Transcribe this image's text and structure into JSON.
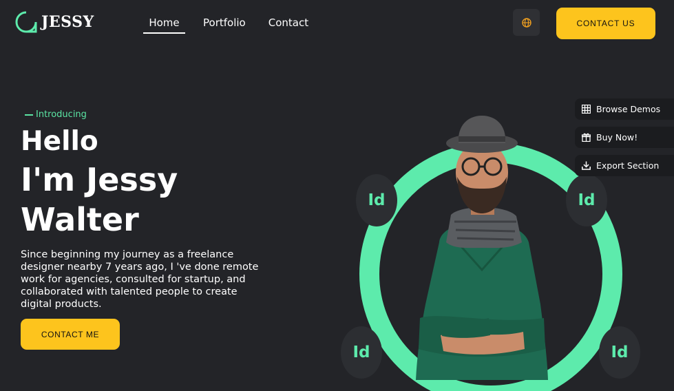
{
  "brand": {
    "name": "JESSY",
    "accent": "#5debac",
    "button_color": "#fdc41d",
    "background": "#232428"
  },
  "nav": {
    "items": [
      {
        "label": "Home",
        "active": true
      },
      {
        "label": "Portfolio"
      },
      {
        "label": "Contact"
      }
    ]
  },
  "header": {
    "language_icon": "globe-icon",
    "contact_button": "CONTACT US"
  },
  "hero": {
    "eyebrow": "Introducing",
    "title_line1": "Hello",
    "title_line2": "I'm Jessy",
    "title_line3": "Walter",
    "description": "Since beginning my journey as a freelance designer nearby 7 years ago, I 've done remote work for agencies, consulted for startup, and collaborated with talented people to create digital products.",
    "cta": "CONTACT ME"
  },
  "badges": {
    "label": "Id"
  },
  "side_panel": {
    "items": [
      {
        "label": "Browse Demos",
        "icon": "grid-icon"
      },
      {
        "label": "Buy Now!",
        "icon": "gift-icon"
      },
      {
        "label": "Export Section",
        "icon": "download-icon"
      }
    ]
  }
}
